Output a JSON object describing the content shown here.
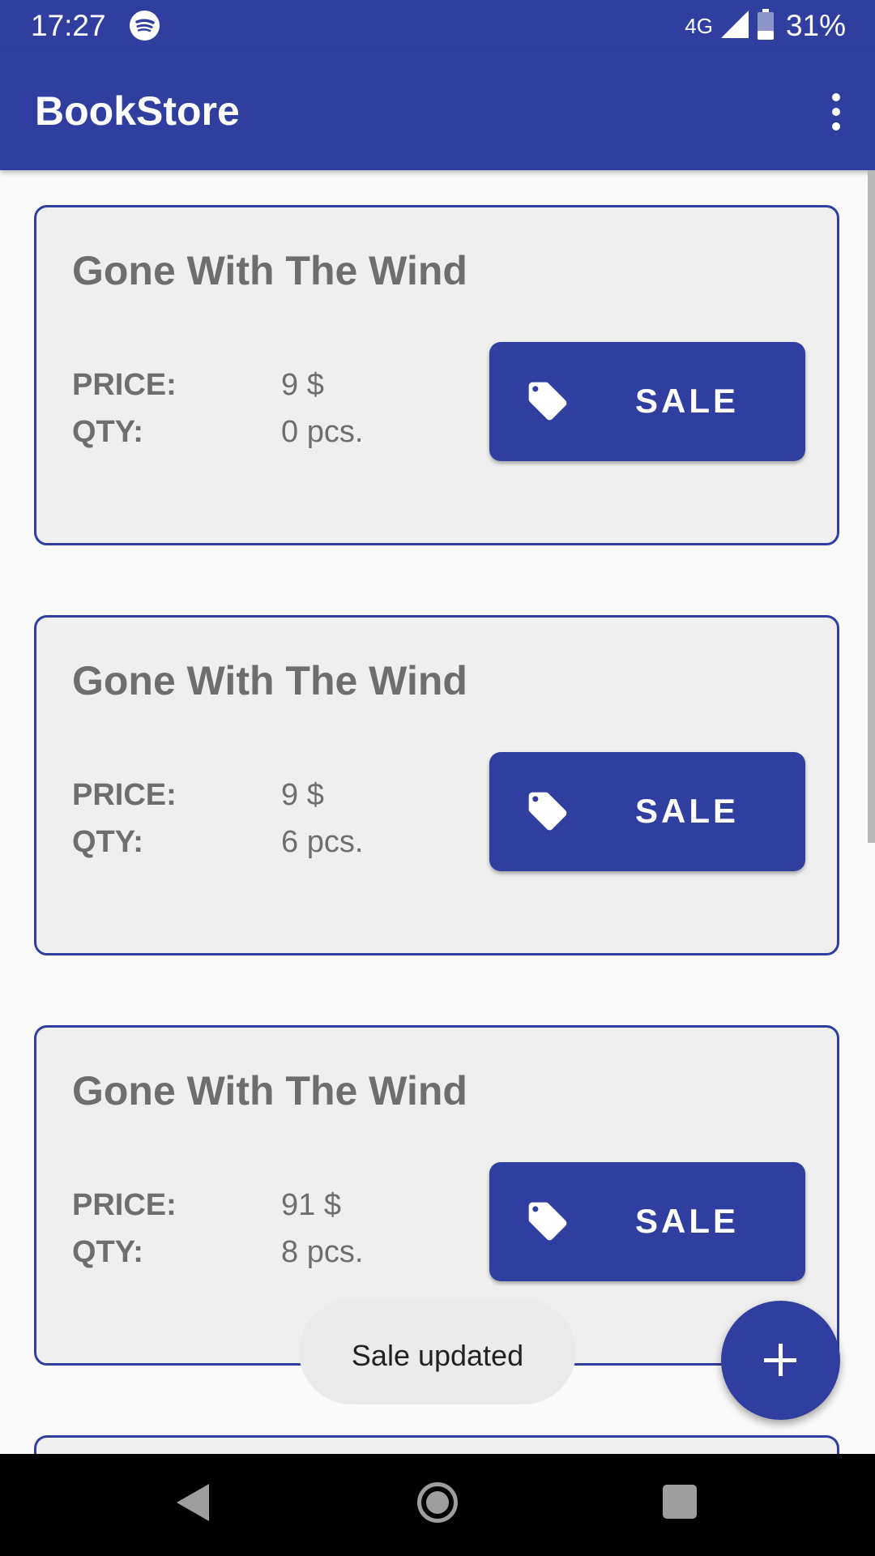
{
  "status_bar": {
    "time": "17:27",
    "network": "4G",
    "battery": "31%",
    "icons": [
      "spotify-icon",
      "signal-icon",
      "battery-icon"
    ]
  },
  "app_bar": {
    "title": "BookStore",
    "menu_icon": "more-vert-icon"
  },
  "books": [
    {
      "title": "Gone With The Wind",
      "price_label": "PRICE:",
      "price": "9 $",
      "qty_label": "QTY:",
      "qty": "0 pcs.",
      "sale_label": "SALE",
      "sale_icon": "tag-icon"
    },
    {
      "title": "Gone With The Wind",
      "price_label": "PRICE:",
      "price": "9 $",
      "qty_label": "QTY:",
      "qty": "6 pcs.",
      "sale_label": "SALE",
      "sale_icon": "tag-icon"
    },
    {
      "title": "Gone With The Wind",
      "price_label": "PRICE:",
      "price": "91 $",
      "qty_label": "QTY:",
      "qty": "8 pcs.",
      "sale_label": "SALE",
      "sale_icon": "tag-icon"
    }
  ],
  "fab": {
    "icon": "plus-icon"
  },
  "toast": {
    "message": "Sale updated"
  },
  "nav_bar": {
    "icons": [
      "back-icon",
      "home-icon",
      "recents-icon"
    ]
  },
  "colors": {
    "primary": "#303f9f",
    "card_background": "#efefef",
    "text_gray": "#6e6e6e",
    "page_background": "#fafafa"
  }
}
